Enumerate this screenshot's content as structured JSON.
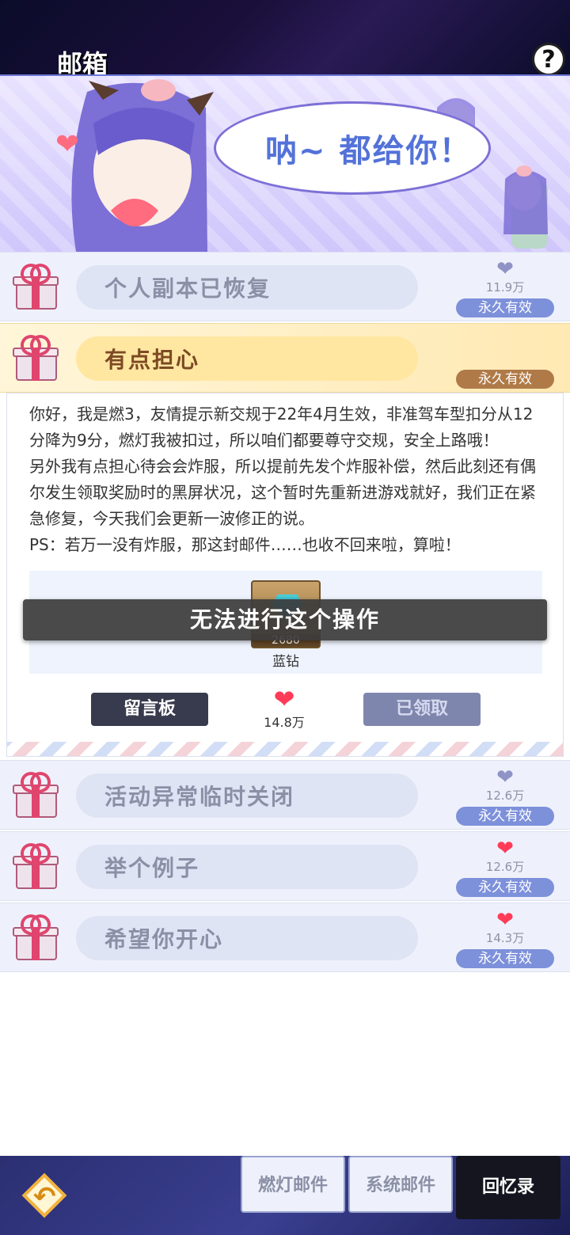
{
  "header": {
    "title": "邮箱",
    "help_icon": "?"
  },
  "banner": {
    "speech": "呐~ 都给你！"
  },
  "mails": [
    {
      "title": "个人副本已恢复",
      "heart_color": "grey",
      "count": "11.9万",
      "badge": "永久有效"
    },
    {
      "title": "有点担心",
      "badge": "永久有效"
    },
    {
      "title": "活动异常临时关闭",
      "heart_color": "grey",
      "count": "12.6万",
      "badge": "永久有效"
    },
    {
      "title": "举个例子",
      "heart_color": "red",
      "count": "12.6万",
      "badge": "永久有效"
    },
    {
      "title": "希望你开心",
      "heart_color": "red",
      "count": "14.3万",
      "badge": "永久有效"
    }
  ],
  "content": {
    "paragraphs": [
      "你好，我是燃3，友情提示新交规于22年4月生效，非准驾车型扣分从12分降为9分，燃灯我被扣过，所以咱们都要尊守交规，安全上路哦！",
      "另外我有点担心待会会炸服，所以提前先发个炸服补偿，然后此刻还有偶尔发生领取奖励时的黑屏状况，这个暂时先重新进游戏就好，我们正在紧急修复，今天我们会更新一波修正的说。",
      "PS：若万一没有炸服，那这封邮件……也收不回来啦，算啦！"
    ],
    "reward": {
      "qty": "2680",
      "name": "蓝钻"
    },
    "toast": "无法进行这个操作",
    "board_button": "留言板",
    "likes": "14.8万",
    "claimed_button": "已领取"
  },
  "bottom": {
    "tabs": [
      "燃灯邮件",
      "系统邮件",
      "回忆录"
    ]
  },
  "colors": {
    "accent": "#7d90da",
    "active_badge": "#b07a48",
    "heart_red": "#ff3b57"
  }
}
